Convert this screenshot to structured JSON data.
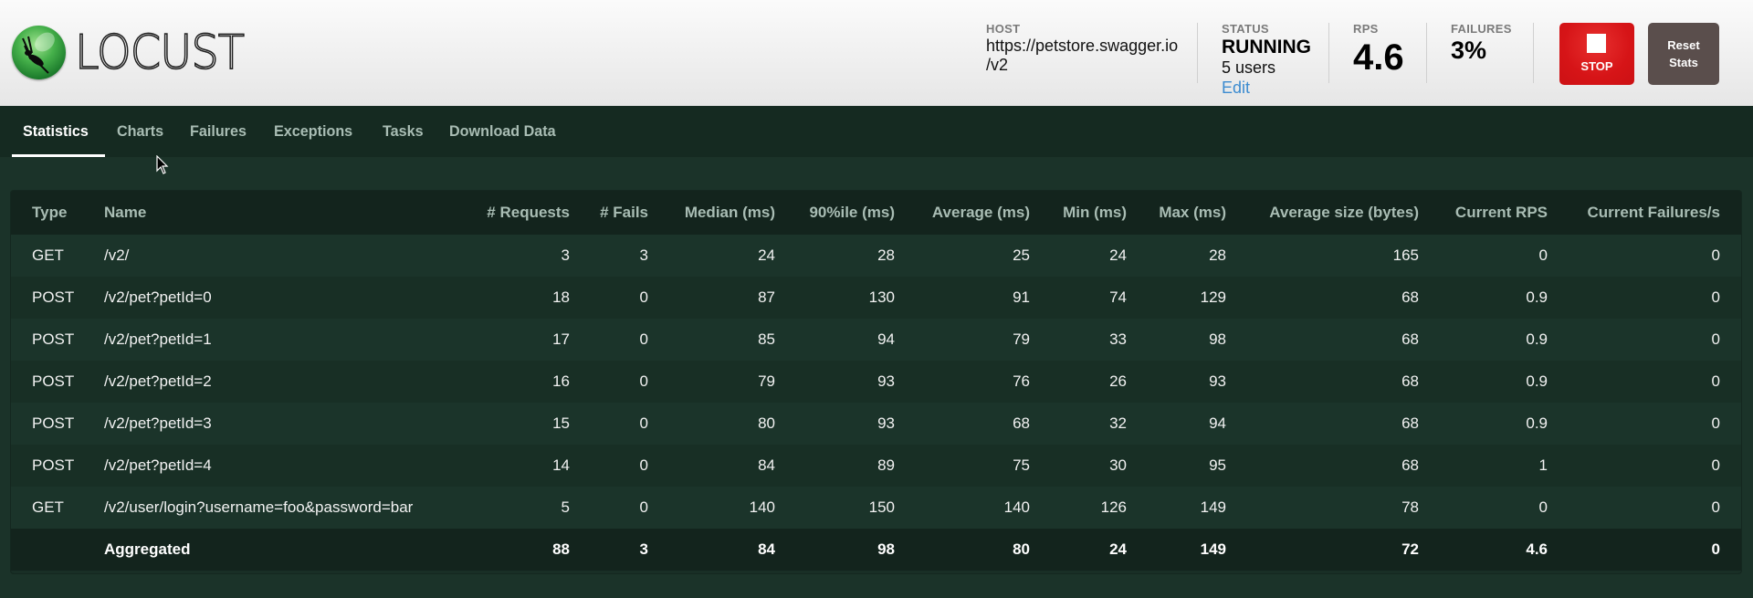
{
  "app": {
    "name": "LOCUST"
  },
  "header": {
    "host": {
      "label": "HOST",
      "line1": "https://petstore.swagger.io",
      "line2": "/v2"
    },
    "status": {
      "label": "STATUS",
      "value": "RUNNING",
      "users": "5 users",
      "edit_label": "Edit"
    },
    "rps": {
      "label": "RPS",
      "value": "4.6"
    },
    "failures": {
      "label": "FAILURES",
      "value": "3%"
    },
    "stop_button": {
      "label": "STOP",
      "color": "#d61417"
    },
    "reset_button": {
      "line1": "Reset",
      "line2": "Stats",
      "color": "#5a4e4c"
    }
  },
  "nav": {
    "tabs": [
      {
        "label": "Statistics",
        "active": true
      },
      {
        "label": "Charts"
      },
      {
        "label": "Failures"
      },
      {
        "label": "Exceptions"
      },
      {
        "label": "Tasks"
      },
      {
        "label": "Download Data"
      }
    ]
  },
  "table": {
    "columns": [
      "Type",
      "Name",
      "# Requests",
      "# Fails",
      "Median (ms)",
      "90%ile (ms)",
      "Average (ms)",
      "Min (ms)",
      "Max (ms)",
      "Average size (bytes)",
      "Current RPS",
      "Current Failures/s"
    ],
    "rows": [
      [
        "GET",
        "/v2/",
        "3",
        "3",
        "24",
        "28",
        "25",
        "24",
        "28",
        "165",
        "0",
        "0"
      ],
      [
        "POST",
        "/v2/pet?petId=0",
        "18",
        "0",
        "87",
        "130",
        "91",
        "74",
        "129",
        "68",
        "0.9",
        "0"
      ],
      [
        "POST",
        "/v2/pet?petId=1",
        "17",
        "0",
        "85",
        "94",
        "79",
        "33",
        "98",
        "68",
        "0.9",
        "0"
      ],
      [
        "POST",
        "/v2/pet?petId=2",
        "16",
        "0",
        "79",
        "93",
        "76",
        "26",
        "93",
        "68",
        "0.9",
        "0"
      ],
      [
        "POST",
        "/v2/pet?petId=3",
        "15",
        "0",
        "80",
        "93",
        "68",
        "32",
        "94",
        "68",
        "0.9",
        "0"
      ],
      [
        "POST",
        "/v2/pet?petId=4",
        "14",
        "0",
        "84",
        "89",
        "75",
        "30",
        "95",
        "68",
        "1",
        "0"
      ],
      [
        "GET",
        "/v2/user/login?username=foo&password=bar",
        "5",
        "0",
        "140",
        "150",
        "140",
        "126",
        "149",
        "78",
        "0",
        "0"
      ]
    ],
    "aggregated": [
      "",
      "Aggregated",
      "88",
      "3",
      "84",
      "98",
      "80",
      "24",
      "149",
      "72",
      "4.6",
      "0"
    ]
  }
}
